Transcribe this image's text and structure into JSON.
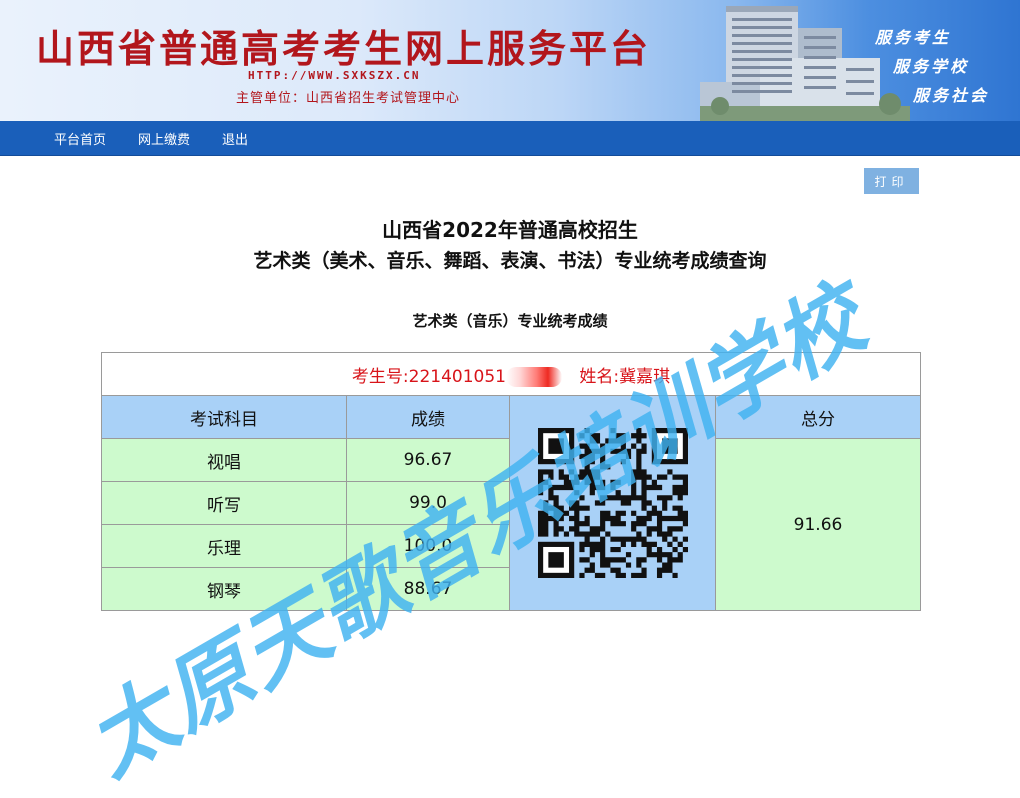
{
  "header": {
    "site_title": "山西省普通高考考生网上服务平台",
    "url": "HTTP://WWW.SXKSZX.CN",
    "sponsor": "主管单位：山西省招生考试管理中心",
    "slogans": [
      "服务考生",
      "服务学校",
      "服务社会"
    ]
  },
  "nav": {
    "items": [
      {
        "label": "平台首页"
      },
      {
        "label": "网上缴费"
      },
      {
        "label": "退出"
      }
    ]
  },
  "toolbar": {
    "print_label": "打印"
  },
  "page": {
    "heading_line1": "山西省2022年普通高校招生",
    "heading_line2": "艺术类（美术、音乐、舞蹈、表演、书法）专业统考成绩查询",
    "section_title": "艺术类（音乐）专业统考成绩"
  },
  "candidate": {
    "exam_no_label": "考生号:",
    "exam_no_visible": "221401051",
    "name_label": "姓名:",
    "name": "冀嘉琪"
  },
  "table": {
    "headers": {
      "subject": "考试科目",
      "score": "成绩",
      "total": "总分"
    },
    "rows": [
      {
        "subject": "视唱",
        "score": "96.67"
      },
      {
        "subject": "听写",
        "score": "99.0"
      },
      {
        "subject": "乐理",
        "score": "100.0"
      },
      {
        "subject": "钢琴",
        "score": "88.67"
      }
    ],
    "total": "91.66"
  },
  "watermark": {
    "text": "太原天歌音乐培训学校",
    "color": "#40b2f0"
  },
  "colors": {
    "banner_title": "#b2161c",
    "nav_bg": "#1a5fba",
    "table_header_bg": "#a9d1f7",
    "table_cell_bg": "#cdfacd",
    "candidate_text": "#d8141a",
    "print_button_bg": "#7fb1e1"
  }
}
